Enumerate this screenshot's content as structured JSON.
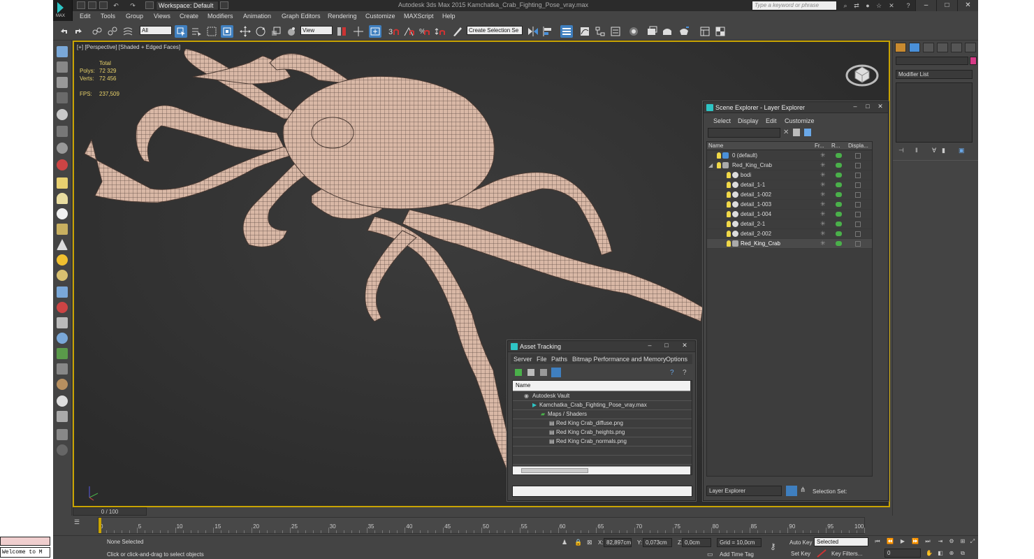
{
  "titlebar": {
    "workspace": "Workspace: Default",
    "app_title": "Autodesk 3ds Max 2015    Kamchatka_Crab_Fighting_Pose_vray.max",
    "search_placeholder": "Type a keyword or phrase",
    "logo_text": "MAX"
  },
  "menu": [
    "Edit",
    "Tools",
    "Group",
    "Views",
    "Create",
    "Modifiers",
    "Animation",
    "Graph Editors",
    "Rendering",
    "Customize",
    "MAXScript",
    "Help"
  ],
  "toolbar": {
    "filter": "All",
    "refcoord": "View",
    "selection_set": "Create Selection Se"
  },
  "viewport": {
    "label": "[+] [Perspective] [Shaded + Edged Faces]",
    "stats": {
      "header": "Total",
      "polys_label": "Polys:",
      "polys": "72 329",
      "verts_label": "Verts:",
      "verts": "72 456",
      "fps_label": "FPS:",
      "fps": "237,509"
    }
  },
  "cmdpanel": {
    "modifier_list": "Modifier List",
    "accent": "#d63a86"
  },
  "scene_explorer": {
    "title": "Scene Explorer - Layer Explorer",
    "menu": [
      "Select",
      "Display",
      "Edit",
      "Customize"
    ],
    "columns": [
      "Name",
      "Fr...",
      "R...",
      "Displa..."
    ],
    "rows": [
      "0 (default)",
      "Red_King_Crab",
      "bodi",
      "detail_1-1",
      "detail_1-002",
      "detail_1-003",
      "detail_1-004",
      "detail_2-1",
      "detail_2-002",
      "Red_King_Crab"
    ],
    "footer_dropdown": "Layer Explorer",
    "footer_label": "Selection Set:"
  },
  "asset_tracking": {
    "title": "Asset Tracking",
    "menu": [
      "Server",
      "File",
      "Paths",
      "Bitmap Performance and Memory",
      "Options"
    ],
    "column": "Name",
    "rows": [
      "Autodesk Vault",
      "Kamchatka_Crab_Fighting_Pose_vray.max",
      "Maps / Shaders",
      "Red King Crab_diffuse.png",
      "Red King Crab_heights.png",
      "Red King Crab_normals.png"
    ]
  },
  "timeline": {
    "slider": "0 / 100",
    "ticks": [
      "0",
      "5",
      "10",
      "15",
      "20",
      "25",
      "30",
      "35",
      "40",
      "45",
      "50",
      "55",
      "60",
      "65",
      "70",
      "75",
      "80",
      "85",
      "90",
      "95",
      "100"
    ]
  },
  "status": {
    "maxscript": "Welcome to M",
    "selected": "None Selected",
    "prompt": "Click or click-and-drag to select objects",
    "x_label": "X:",
    "x": "82,897cm",
    "y_label": "Y:",
    "y": "0,073cm",
    "z_label": "Z:",
    "z": "0,0cm",
    "grid": "Grid = 10,0cm",
    "add_time_tag": "Add Time Tag",
    "auto_key": "Auto Key",
    "set_key": "Set Key",
    "key_mode": "Selected",
    "key_filters": "Key Filters...",
    "frame": "0"
  }
}
